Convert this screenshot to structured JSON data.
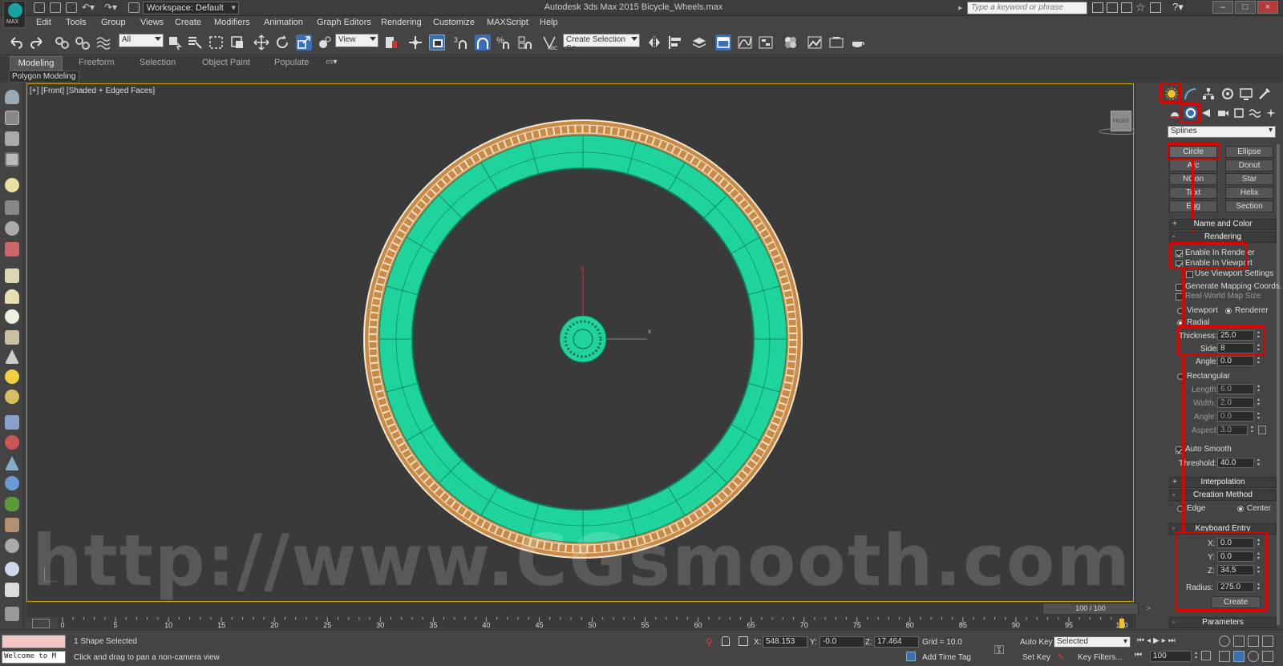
{
  "app": {
    "logo_text": "MAX",
    "workspace": "Workspace: Default",
    "title": "Autodesk 3ds Max  2015    Bicycle_Wheels.max",
    "search_placeholder": "Type a keyword or phrase",
    "window_buttons": [
      "–",
      "□",
      "×"
    ]
  },
  "menu": [
    "Edit",
    "Tools",
    "Group",
    "Views",
    "Create",
    "Modifiers",
    "Animation",
    "Graph Editors",
    "Rendering",
    "Customize",
    "MAXScript",
    "Help"
  ],
  "toolbar": {
    "selection_filter": "All",
    "ref_coord": "View",
    "selection_set": "Create Selection Se"
  },
  "ribbon": {
    "tabs": [
      "Modeling",
      "Freeform",
      "Selection",
      "Object Paint",
      "Populate"
    ],
    "panel_label": "Polygon Modeling"
  },
  "viewport": {
    "label": "[+] [Front] [Shaded + Edged Faces]",
    "viewcube_label": "FRONT",
    "axis_x": "x",
    "axis_y": "y",
    "watermark": "http://www.CGsmooth.com",
    "colors": {
      "tire": "#d08a3c",
      "rim": "#1fd49c",
      "hub": "#1fd49c",
      "background": "#3a3a3a",
      "highlight": "#e00000"
    }
  },
  "command_panel": {
    "category": "Splines",
    "object_types": [
      "Circle",
      "Ellipse",
      "Arc",
      "Donut",
      "NGon",
      "Star",
      "Text",
      "Helix",
      "Egg",
      "Section"
    ],
    "name_and_color": "Name and Color",
    "rendering": {
      "title": "Rendering",
      "enable_in_renderer": "Enable In Renderer",
      "enable_in_viewport": "Enable In Viewport",
      "use_viewport_settings": "Use Viewport Settings",
      "generate_mapping": "Generate Mapping Coords.",
      "real_world": "Real-World Map Size",
      "viewport_radio": "Viewport",
      "renderer_radio": "Renderer",
      "radial": "Radial",
      "thickness_label": "Thickness:",
      "thickness": "25.0",
      "sides_label": "Sides:",
      "sides": "8",
      "angle_label": "Angle:",
      "angle": "0.0",
      "rectangular": "Rectangular",
      "length_label": "Length:",
      "length": "6.0",
      "width_label": "Width:",
      "width": "2.0",
      "rect_angle_label": "Angle:",
      "rect_angle": "0.0",
      "aspect_label": "Aspect:",
      "aspect": "3.0",
      "auto_smooth": "Auto Smooth",
      "threshold_label": "Threshold:",
      "threshold": "40.0"
    },
    "interpolation": "Interpolation",
    "creation_method": {
      "title": "Creation Method",
      "edge": "Edge",
      "center": "Center"
    },
    "keyboard_entry": {
      "title": "Keyboard Entry",
      "x_label": "X:",
      "x": "0.0",
      "y_label": "Y:",
      "y": "0.0",
      "z_label": "Z:",
      "z": "34.5",
      "radius_label": "Radius:",
      "radius": "275.0",
      "create": "Create"
    },
    "parameters": "Parameters"
  },
  "timeline": {
    "frame_counter": "100 / 100",
    "ticks": [
      "0",
      "5",
      "10",
      "15",
      "20",
      "25",
      "30",
      "35",
      "40",
      "45",
      "50",
      "55",
      "60",
      "65",
      "70",
      "75",
      "80",
      "85",
      "90",
      "95",
      "100"
    ]
  },
  "status": {
    "maxscript_text": "Welcome to M",
    "selection": "1 Shape Selected",
    "prompt": "Click and drag to pan a non-camera view",
    "x_label": "X:",
    "x": "548.153",
    "y_label": "Y:",
    "y": "-0.0",
    "z_label": "Z:",
    "z": "17.464",
    "grid": "Grid = 10.0",
    "add_time_tag": "Add Time Tag",
    "auto_key": "Auto Key",
    "set_key": "Set Key",
    "selected": "Selected",
    "key_filters": "Key Filters...",
    "frame": "100"
  }
}
